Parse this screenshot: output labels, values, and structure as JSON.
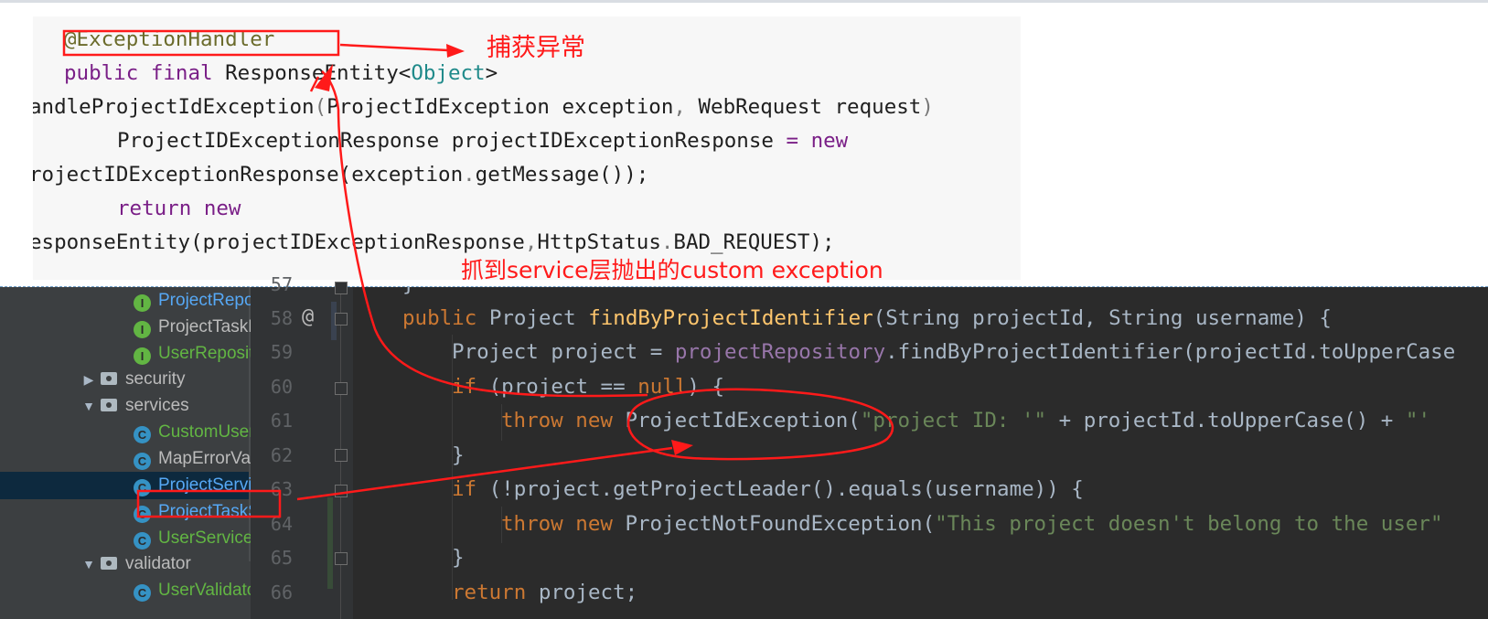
{
  "snippet": {
    "line1": "@ExceptionHandler",
    "line2_kw": "public final ",
    "line2_type": "ResponseEntity",
    "line2_lt": "<",
    "line2_gen": "Object",
    "line2_gt": ">",
    "line3_name": "andleProjectIdException",
    "line3_open": "(",
    "line3_args": "ProjectIdException exception",
    "line3_comma": ", ",
    "line3_args2": "WebRequest request",
    "line3_close": ") ",
    "line4_type": "ProjectIDExceptionResponse projectIDExceptionResponse ",
    "line4_eq": "= ",
    "line4_new": "new",
    "line5_type": "rojectIDExceptionResponse",
    "line5_rest": "(exception",
    "line5_dot": ".",
    "line5_call": "getMessage",
    "line5_end": "());",
    "line6_kw": "return new",
    "line7_type": "esponseEntity",
    "line7_rest": "(projectIDExceptionResponse",
    "line7_comma": ",",
    "line7_status": "HttpStatus",
    "line7_dot": ".",
    "line7_const": "BAD_REQUEST",
    "line7_end": ");"
  },
  "tree": {
    "items": [
      {
        "label": "ProjectRepos",
        "icon": "I",
        "color": "green"
      },
      {
        "label": "ProjectTaskR",
        "icon": "I",
        "color": "plain"
      },
      {
        "label": "UserReposito",
        "icon": "I",
        "color": "green"
      },
      {
        "label": "security",
        "arrow": "▶",
        "kind": "folder"
      },
      {
        "label": "services",
        "arrow": "▼",
        "kind": "folder"
      },
      {
        "label": "CustomUserI",
        "icon": "C",
        "color": "green"
      },
      {
        "label": "MapErrorVal",
        "icon": "C",
        "color": "plain"
      },
      {
        "label": "ProjectServic",
        "icon": "C",
        "color": "blue",
        "selected": true
      },
      {
        "label": "ProjectTaskS",
        "icon": "C",
        "color": "green"
      },
      {
        "label": "UserService",
        "icon": "C",
        "color": "green"
      },
      {
        "label": "validator",
        "arrow": "▼",
        "kind": "folder"
      },
      {
        "label": "UserValidato",
        "icon": "C",
        "color": "green"
      }
    ]
  },
  "gutter": {
    "lines": [
      "57",
      "58",
      "59",
      "60",
      "61",
      "62",
      "63",
      "64",
      "65",
      "66"
    ],
    "at_symbol": "@"
  },
  "code": {
    "l57": "}",
    "l58_kw": "public ",
    "l58_type": "Project ",
    "l58_fn": "findByProjectIdentifier",
    "l58_rest": "(String projectId, String username) {",
    "l59_a": "Project project = ",
    "l59_fld": "projectRepository",
    "l59_b": ".findByProjectIdentifier(projectId.toUpperCase",
    "l60_kw": "if ",
    "l60_a": "(project == ",
    "l60_null": "null",
    "l60_b": ") {",
    "l61_kw": "throw new ",
    "l61_a": "ProjectIdException(",
    "l61_str": "\"project ID: '\"",
    "l61_b": " + projectId.toUpperCase() + ",
    "l61_str2": "\"'",
    "l62": "}",
    "l63_kw": "if ",
    "l63_a": "(!project.getProjectLeader().equals(username)) {",
    "l64_kw": "throw new ",
    "l64_a": "ProjectNotFoundException(",
    "l64_str": "\"This project doesn't belong to the user\"",
    "l65": "}",
    "l66_kw": "return ",
    "l66_a": "project;"
  },
  "annotations": {
    "catch_label": "捕获异常",
    "service_label": "抓到service层抛出的custom exception"
  },
  "colors": {
    "annotation": "#ff1a1a",
    "ide_bg": "#2b2b2b",
    "tree_bg": "#3c3f41"
  }
}
